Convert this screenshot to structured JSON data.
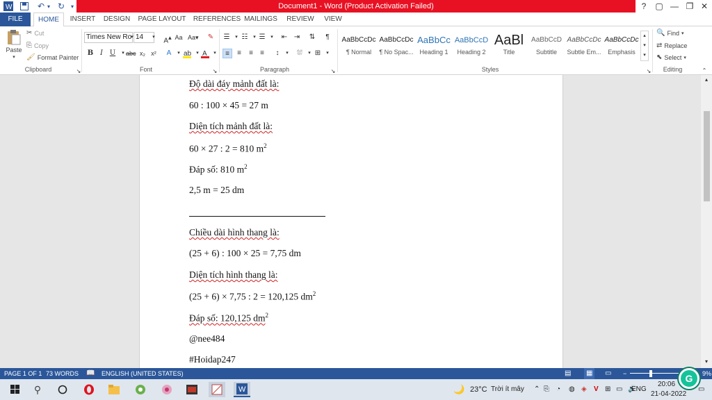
{
  "window": {
    "title": "Document1 - Word (Product Activation Failed)",
    "controls": {
      "help": "?",
      "restore_ribbon": "▢",
      "minimize": "—",
      "maximize": "❐",
      "close": "✕"
    }
  },
  "tabs": [
    "FILE",
    "HOME",
    "INSERT",
    "DESIGN",
    "PAGE LAYOUT",
    "REFERENCES",
    "MAILINGS",
    "REVIEW",
    "VIEW"
  ],
  "clipboard": {
    "paste": "Paste",
    "cut": "Cut",
    "copy": "Copy",
    "format_painter": "Format Painter",
    "label": "Clipboard"
  },
  "font": {
    "name": "Times New Ro",
    "size": "14",
    "label": "Font"
  },
  "paragraph": {
    "label": "Paragraph"
  },
  "styles": {
    "label": "Styles",
    "items": [
      {
        "preview": "AaBbCcDc",
        "name": "¶ Normal"
      },
      {
        "preview": "AaBbCcDc",
        "name": "¶ No Spac..."
      },
      {
        "preview": "AaBbCc",
        "name": "Heading 1"
      },
      {
        "preview": "AaBbCcD",
        "name": "Heading 2"
      },
      {
        "preview": "AaBl",
        "name": "Title"
      },
      {
        "preview": "AaBbCcD",
        "name": "Subtitle"
      },
      {
        "preview": "AaBbCcDc",
        "name": "Subtle Em..."
      },
      {
        "preview": "AaBbCcDc",
        "name": "Emphasis"
      }
    ]
  },
  "editing": {
    "find": "Find",
    "replace": "Replace",
    "select": "Select",
    "label": "Editing"
  },
  "document": {
    "l1": "Độ dài đáy mảnh đất là:",
    "l2": "60 : 100 × 45 = 27 m",
    "l3": "Diện tích mảnh đất là:",
    "l4": "60 × 27 : 2 = 810 m",
    "l4sup": "2",
    "l5": "Đáp số: 810 m",
    "l5sup": "2",
    "l6": "2,5 m = 25 dm",
    "l7": "Chiều dài hình thang là:",
    "l8": "(25 + 6) : 100 × 25  = 7,75 dm",
    "l9": "Diện tích hình thang là:",
    "l10": "(25 + 6) × 7,75 : 2 = 120,125 dm",
    "l10sup": "2",
    "l11": "Đáp số: 120,125 dm",
    "l11sup": "2",
    "l12": "@nee484",
    "l13": "#Hoidap247"
  },
  "status": {
    "page": "PAGE 1 OF 1",
    "words": "73 WORDS",
    "language": "ENGLISH (UNITED STATES)",
    "zoom": "9%"
  },
  "taskbar": {
    "temp": "23°C",
    "weather": "Trời ít mây",
    "lang": "ENG",
    "time": "20:06",
    "date": "21-04-2022"
  },
  "colors": {
    "word_blue": "#2b579a",
    "title_red": "#e81123"
  }
}
